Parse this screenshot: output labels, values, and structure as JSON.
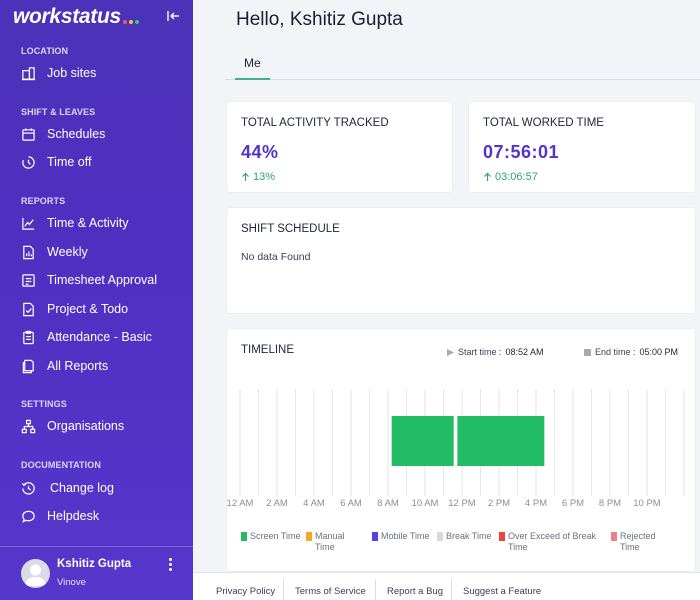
{
  "brand": {
    "name": "workstatus",
    "dot_colors": [
      "#ff4d6d",
      "#ffc233",
      "#2bd17e"
    ]
  },
  "sidebar": {
    "sections": [
      {
        "title": "LOCATION",
        "items": [
          {
            "label": "Job sites",
            "icon": "building-icon"
          }
        ]
      },
      {
        "title": "SHIFT & LEAVES",
        "items": [
          {
            "label": "Schedules",
            "icon": "calendar-icon"
          },
          {
            "label": "Time off",
            "icon": "timer-icon"
          }
        ]
      },
      {
        "title": "REPORTS",
        "items": [
          {
            "label": "Time & Activity",
            "icon": "line-chart-icon"
          },
          {
            "label": "Weekly",
            "icon": "report-doc-icon"
          },
          {
            "label": "Timesheet Approval",
            "icon": "timesheet-icon"
          },
          {
            "label": "Project & Todo",
            "icon": "checklist-icon"
          },
          {
            "label": "Attendance - Basic",
            "icon": "clipboard-icon"
          },
          {
            "label": "All Reports",
            "icon": "reports-icon"
          }
        ]
      },
      {
        "title": "SETTINGS",
        "items": [
          {
            "label": "Organisations",
            "icon": "org-icon"
          }
        ]
      },
      {
        "title": "DOCUMENTATION",
        "items": [
          {
            "label": "Change log",
            "icon": "history-icon"
          },
          {
            "label": "Helpdesk",
            "icon": "chat-icon"
          }
        ]
      }
    ],
    "user": {
      "name": "Kshitiz Gupta",
      "org": "Vinove"
    }
  },
  "main": {
    "greeting": "Hello, Kshitiz Gupta",
    "tab": "Me",
    "activity": {
      "title": "TOTAL ACTIVITY TRACKED",
      "value": "44%",
      "delta": "13%"
    },
    "worked": {
      "title": "TOTAL WORKED TIME",
      "value": "07:56:01",
      "delta": "03:06:57"
    },
    "shift": {
      "title": "SHIFT SCHEDULE",
      "empty": "No data Found"
    },
    "timeline": {
      "title": "TIMELINE",
      "start_label": "Start time :",
      "start_value": "08:52 AM",
      "end_label": "End time :",
      "end_value": "05:00 PM"
    }
  },
  "chart_data": {
    "type": "bar",
    "title": "TIMELINE",
    "x_tick_labels": [
      "12 AM",
      "2 AM",
      "4 AM",
      "6 AM",
      "8 AM",
      "10 AM",
      "12 PM",
      "2 PM",
      "4 PM",
      "6 PM",
      "8 PM",
      "10 PM"
    ],
    "xlim_hours": [
      0,
      24
    ],
    "grid": true,
    "segments": [
      {
        "series": "Screen Time",
        "start_hour": 8.2,
        "end_hour": 11.55
      },
      {
        "series": "Screen Time",
        "start_hour": 11.75,
        "end_hour": 16.45
      }
    ],
    "legend": [
      {
        "name": "Screen Time",
        "color": "#22bb66"
      },
      {
        "name": "Manual Time",
        "color": "#f7a823"
      },
      {
        "name": "Mobile Time",
        "color": "#5b3ee0"
      },
      {
        "name": "Break Time",
        "color": "#d8d9de"
      },
      {
        "name": "Over Exceed of Break Time",
        "color": "#ee4444"
      },
      {
        "name": "Rejected Time",
        "color": "#ee7f88"
      }
    ]
  },
  "footer": {
    "links": [
      "Privacy Policy",
      "Terms of Service",
      "Report a Bug",
      "Suggest a Feature"
    ]
  }
}
